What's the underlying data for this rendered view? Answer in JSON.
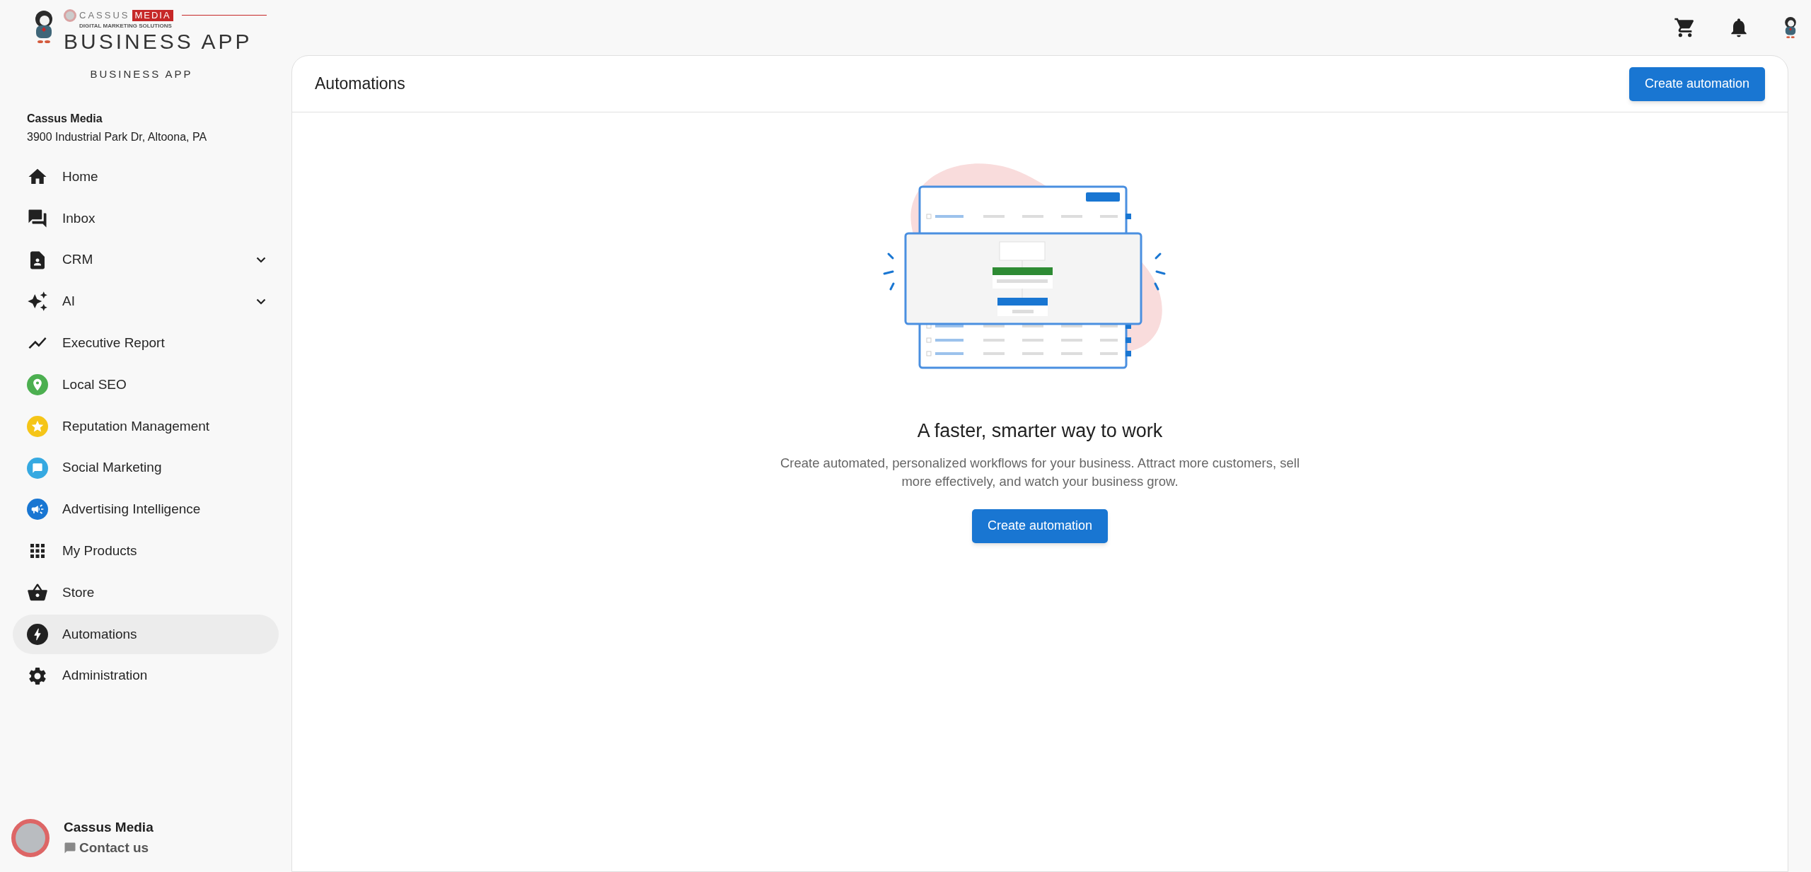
{
  "logo": {
    "brand": "CASSUS",
    "brand_highlight": "MEDIA",
    "tagline": "DIGITAL MARKETING SOLUTIONS",
    "product": "BUSINESS APP"
  },
  "app_name": "BUSINESS APP",
  "account": {
    "name": "Cassus Media",
    "address": "3900 Industrial Park Dr, Altoona, PA"
  },
  "nav": [
    {
      "label": "Home",
      "expandable": false,
      "selected": false
    },
    {
      "label": "Inbox",
      "expandable": false,
      "selected": false
    },
    {
      "label": "CRM",
      "expandable": true,
      "selected": false
    },
    {
      "label": "AI",
      "expandable": true,
      "selected": false
    },
    {
      "label": "Executive Report",
      "expandable": false,
      "selected": false
    },
    {
      "label": "Local SEO",
      "expandable": false,
      "selected": false
    },
    {
      "label": "Reputation Management",
      "expandable": false,
      "selected": false
    },
    {
      "label": "Social Marketing",
      "expandable": false,
      "selected": false
    },
    {
      "label": "Advertising Intelligence",
      "expandable": false,
      "selected": false
    },
    {
      "label": "My Products",
      "expandable": false,
      "selected": false
    },
    {
      "label": "Store",
      "expandable": false,
      "selected": false
    },
    {
      "label": "Automations",
      "expandable": false,
      "selected": true
    },
    {
      "label": "Administration",
      "expandable": false,
      "selected": false
    }
  ],
  "profile": {
    "name": "Cassus Media",
    "contact": "Contact us"
  },
  "panel": {
    "title": "Automations",
    "header_button": "Create automation"
  },
  "empty_state": {
    "heading": "A faster, smarter way to work",
    "description": "Create automated, personalized workflows for your business. Attract more customers, sell more effectively, and watch your business grow.",
    "button": "Create automation"
  }
}
